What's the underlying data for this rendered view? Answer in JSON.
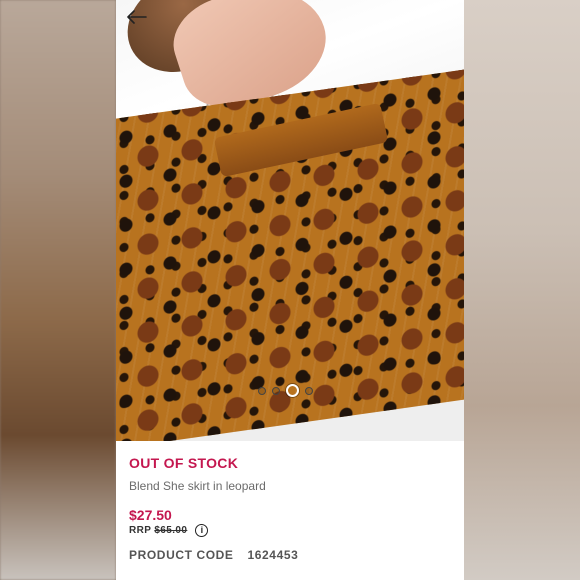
{
  "product": {
    "stock_status": "OUT OF STOCK",
    "name": "Blend She skirt in leopard",
    "price": "$27.50",
    "rrp_label": "RRP",
    "rrp_value": "$65.00",
    "product_code_label": "PRODUCT CODE",
    "product_code": "1624453"
  },
  "carousel": {
    "slide_count": 4,
    "active_slide": 3
  },
  "icons": {
    "back": "back-arrow-icon",
    "info": "info-icon"
  },
  "colors": {
    "accent": "#c4174f",
    "text_muted": "#6b6b6b"
  }
}
